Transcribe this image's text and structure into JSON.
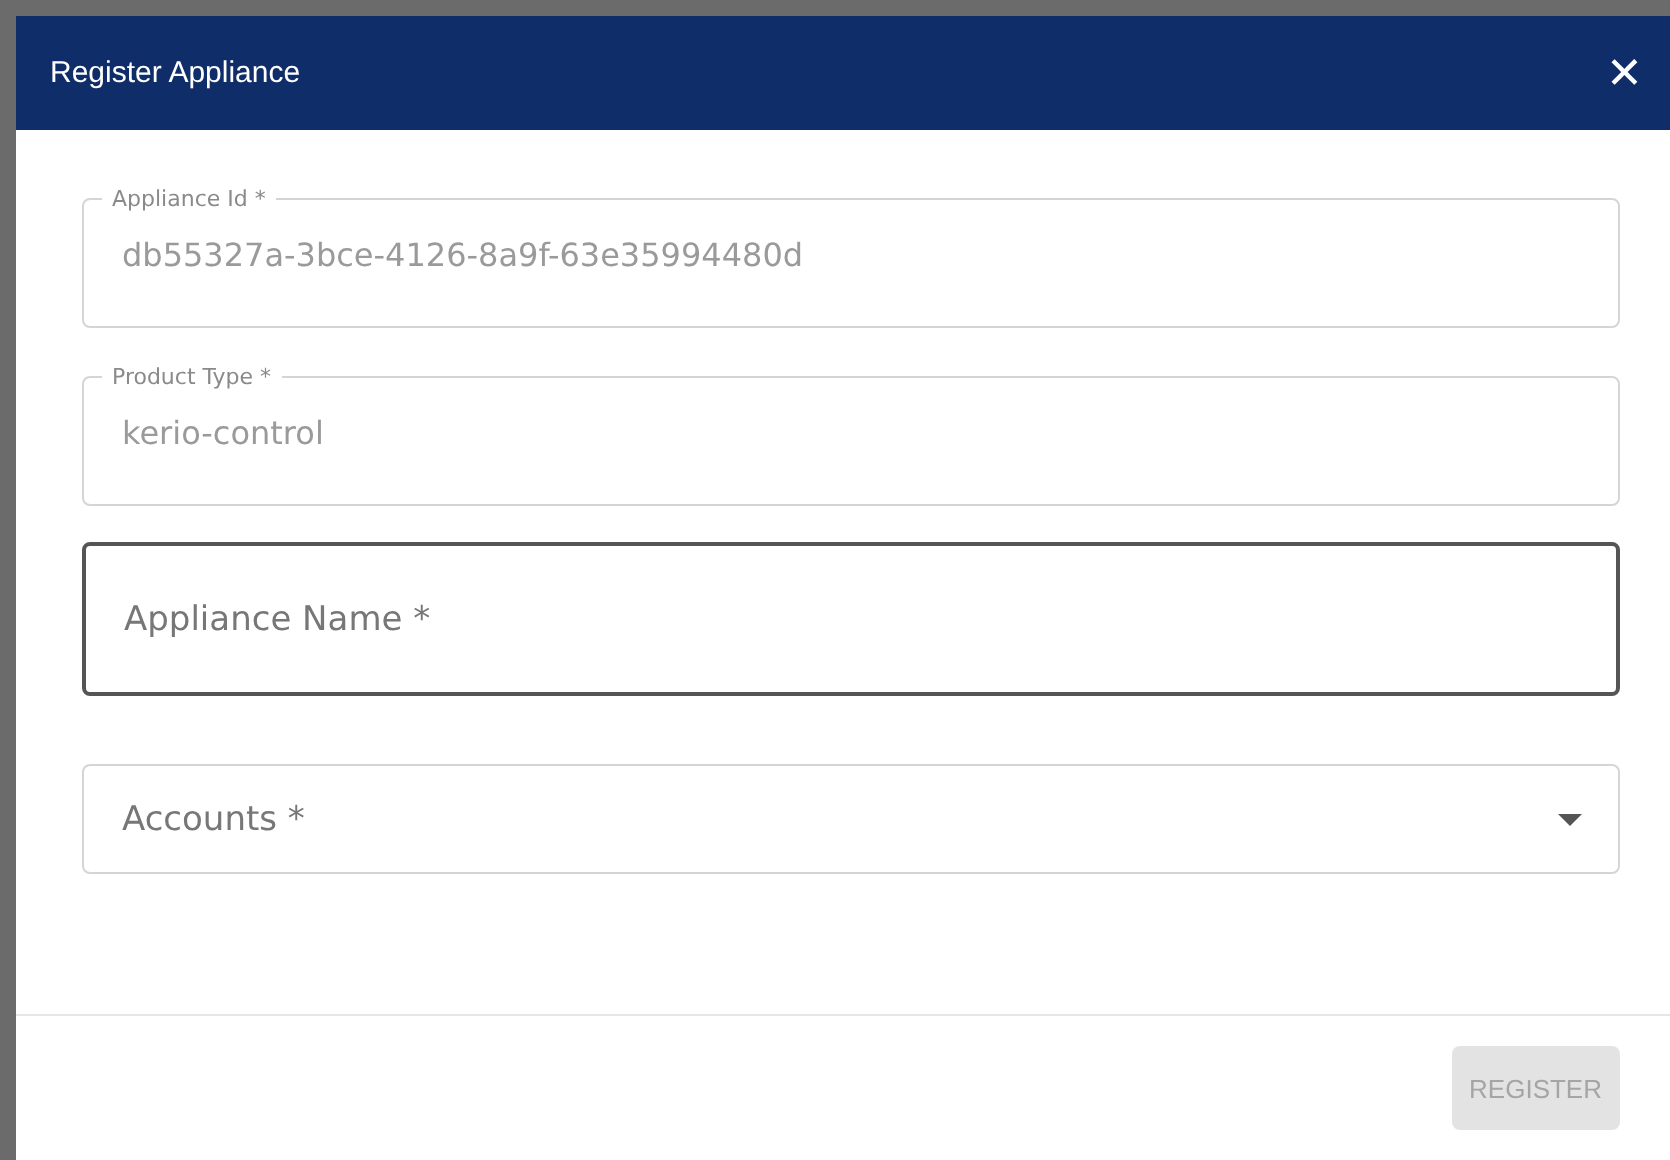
{
  "dialog": {
    "title": "Register Appliance",
    "close": "✕"
  },
  "fields": [
    {
      "kind": "filled",
      "label": "Appliance Id *",
      "value": "db55327a-3bce-4126-8a9f-63e35994480d",
      "focused": false
    },
    {
      "kind": "filled",
      "label": "Product Type *",
      "value": "kerio-control",
      "focused": false
    },
    {
      "kind": "input",
      "placeholder": "Appliance Name *",
      "focused": true
    },
    {
      "kind": "select",
      "placeholder": "Accounts *",
      "focused": false
    }
  ],
  "footer": {
    "button": {
      "label": "REGISTER",
      "disabled": true
    }
  }
}
